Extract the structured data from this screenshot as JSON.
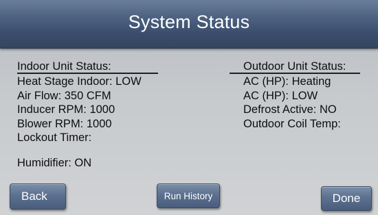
{
  "header": {
    "title": "System Status"
  },
  "indoor": {
    "heading": "Indoor Unit Status:",
    "lines": [
      "Heat Stage Indoor: LOW",
      "Air Flow: 350 CFM",
      "Inducer RPM: 1000",
      "Blower RPM: 1000",
      "Lockout Timer:"
    ],
    "humidifier": "Humidifier: ON"
  },
  "outdoor": {
    "heading": "Outdoor Unit Status:",
    "lines": [
      "AC (HP): Heating",
      "AC (HP): LOW",
      "Defrost Active: NO",
      "Outdoor Coil Temp:"
    ]
  },
  "buttons": {
    "back": "Back",
    "run_history": "Run History",
    "done": "Done"
  },
  "colors": {
    "header_bg": "#3a4d6c",
    "button_bg": "#5c7090",
    "panel_bg": "#c7cacd",
    "text": "#0d0d0d"
  }
}
